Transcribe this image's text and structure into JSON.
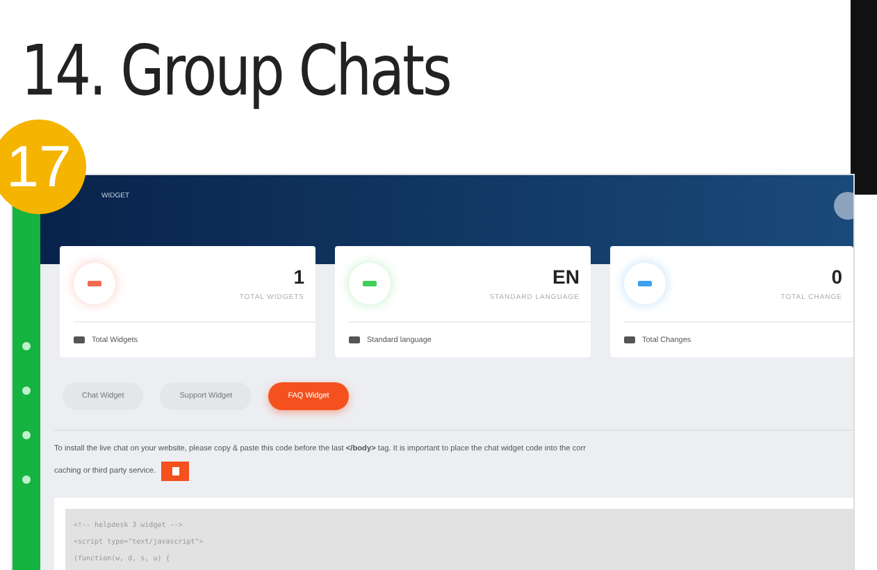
{
  "slide": {
    "title": "14. Group Chats",
    "badge": "17"
  },
  "app": {
    "header": {
      "title": "WIDGET"
    },
    "cards": [
      {
        "value": "1",
        "label": "TOTAL WIDGETS",
        "footer": "Total Widgets",
        "color": "#f46a4e"
      },
      {
        "value": "EN",
        "label": "STANDARD LANGUAGE",
        "footer": "Standard language",
        "color": "#3fcf5a"
      },
      {
        "value": "0",
        "label": "TOTAL CHANGE",
        "footer": "Total Changes",
        "color": "#3aa0f0"
      }
    ],
    "tabs": [
      {
        "label": "Chat Widget",
        "selected": false
      },
      {
        "label": "Support Widget",
        "selected": false
      },
      {
        "label": "FAQ Widget",
        "selected": true
      }
    ],
    "instructions": [
      "To install the live chat on your website, please copy & paste this code before the last **</body>** tag. It is important to place the chat widget code into the corr",
      "caching or third party service."
    ],
    "code_lines": [
      "<!-- helpdesk 3 widget -->",
      "<script type=\"text/javascript\">",
      "(function(w, d, s, u) {"
    ]
  }
}
